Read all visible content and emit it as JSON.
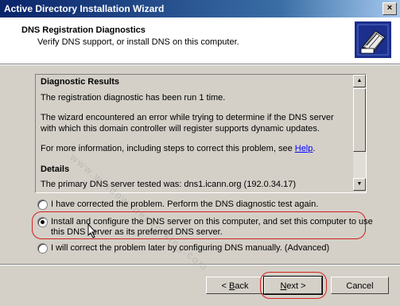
{
  "window": {
    "title": "Active Directory Installation Wizard",
    "close_label": "×"
  },
  "header": {
    "title": "DNS Registration Diagnostics",
    "subtitle": "Verify DNS support, or install DNS on this computer."
  },
  "diagnostics": {
    "results_heading": "Diagnostic Results",
    "run_line": "The registration diagnostic has been run 1 time.",
    "error_line": "The wizard encountered an error while trying to determine if the DNS server with which this domain controller will register supports dynamic updates.",
    "info_prefix": "For more information, including steps to correct this problem, see ",
    "help_link": "Help",
    "info_suffix": ".",
    "details_heading": "Details",
    "server_line": "The primary DNS server tested was: dns1.icann.org (192.0.34.17)"
  },
  "options": [
    {
      "label": "I have corrected the problem. Perform the DNS diagnostic test again.",
      "selected": false
    },
    {
      "label": "Install and configure the DNS server on this computer, and set this computer to use",
      "label2": "this DNS server as its preferred DNS server.",
      "selected": true
    },
    {
      "label": "I will correct the problem later by configuring DNS manually. (Advanced)",
      "selected": false
    }
  ],
  "buttons": {
    "back_prefix": "< ",
    "back_accel": "B",
    "back_rest": "ack",
    "next_accel": "N",
    "next_rest": "ext >",
    "cancel": "Cancel"
  },
  "watermark": "www.windowsnetworking.com",
  "colors": {
    "titlebar": "#0a246a",
    "dialog_bg": "#d4d0c8",
    "highlight": "#d22020",
    "link": "#0000ff"
  }
}
